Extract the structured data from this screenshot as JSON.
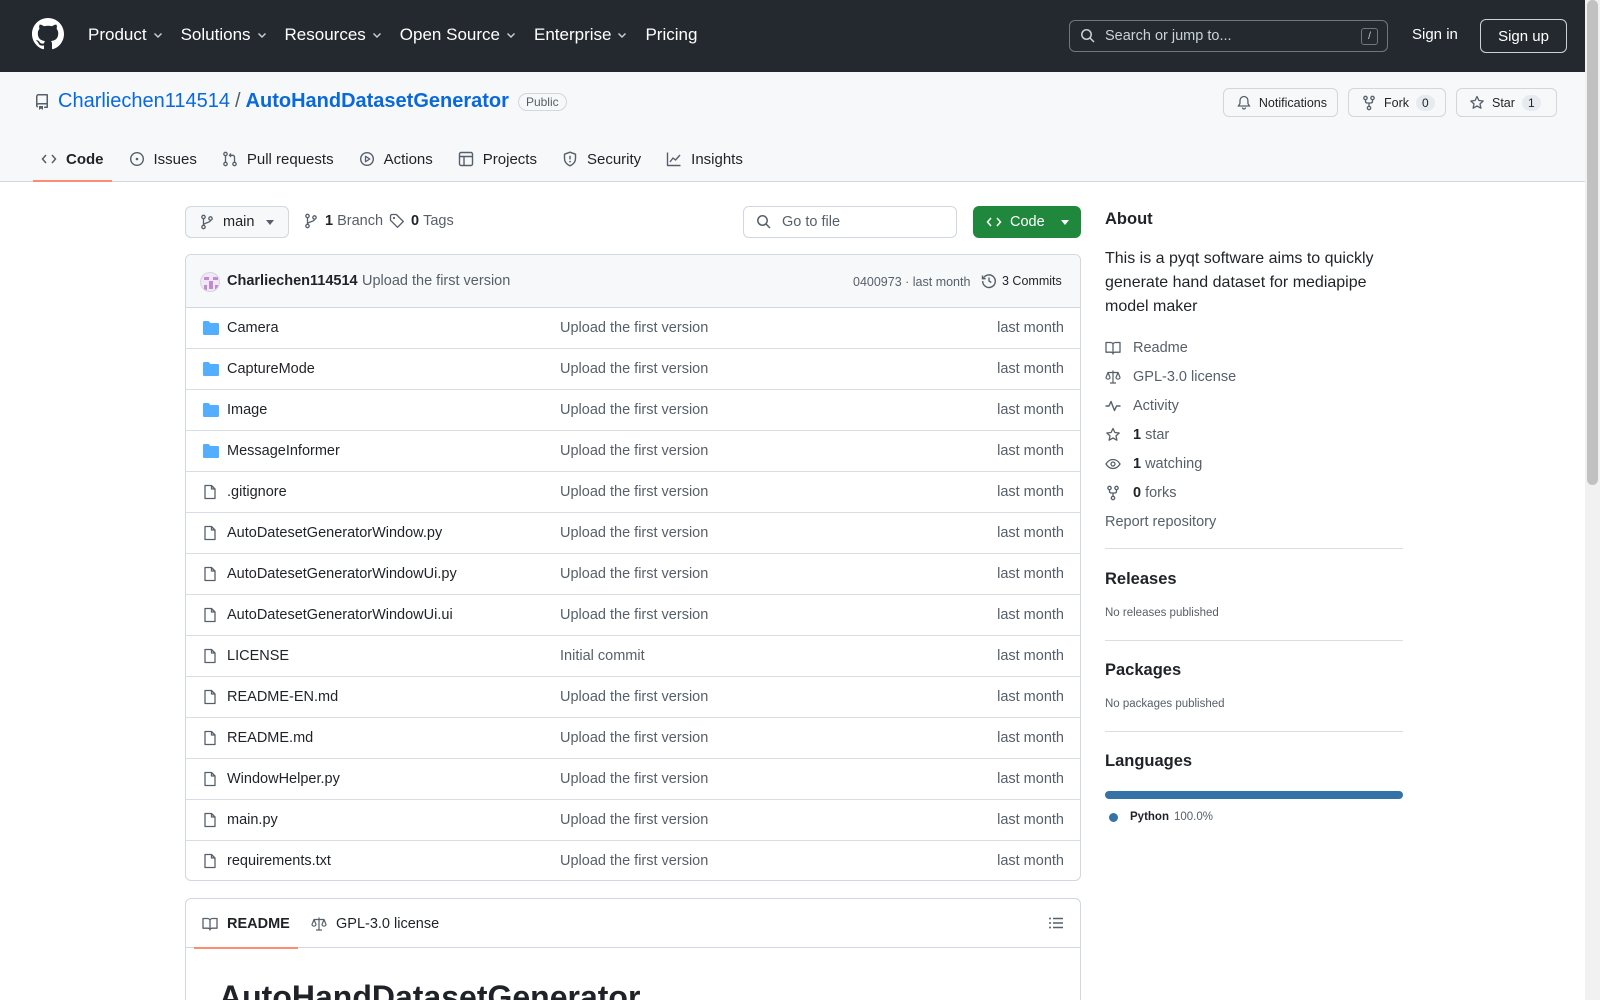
{
  "header": {
    "nav": [
      "Product",
      "Solutions",
      "Resources",
      "Open Source",
      "Enterprise",
      "Pricing"
    ],
    "search_placeholder": "Search or jump to...",
    "search_shortcut": "/",
    "sign_in": "Sign in",
    "sign_up": "Sign up"
  },
  "repo": {
    "owner": "Charliechen114514",
    "separator": "/",
    "name": "AutoHandDatasetGenerator",
    "visibility": "Public",
    "notifications_label": "Notifications",
    "fork_label": "Fork",
    "fork_count": "0",
    "star_label": "Star",
    "star_count": "1",
    "tabs": [
      "Code",
      "Issues",
      "Pull requests",
      "Actions",
      "Projects",
      "Security",
      "Insights"
    ]
  },
  "toolbar": {
    "branch": "main",
    "branch_count": "1",
    "branch_label": "Branch",
    "tag_count": "0",
    "tag_label": "Tags",
    "goto_placeholder": "Go to file",
    "code_label": "Code"
  },
  "commit": {
    "author": "Charliechen114514",
    "message": "Upload the first version",
    "meta": "0400973 · last month",
    "count": "3 Commits"
  },
  "files": [
    {
      "type": "dir",
      "name": "Camera",
      "message": "Upload the first version",
      "date": "last month"
    },
    {
      "type": "dir",
      "name": "CaptureMode",
      "message": "Upload the first version",
      "date": "last month"
    },
    {
      "type": "dir",
      "name": "Image",
      "message": "Upload the first version",
      "date": "last month"
    },
    {
      "type": "dir",
      "name": "MessageInformer",
      "message": "Upload the first version",
      "date": "last month"
    },
    {
      "type": "file",
      "name": ".gitignore",
      "message": "Upload the first version",
      "date": "last month"
    },
    {
      "type": "file",
      "name": "AutoDatesetGeneratorWindow.py",
      "message": "Upload the first version",
      "date": "last month"
    },
    {
      "type": "file",
      "name": "AutoDatesetGeneratorWindowUi.py",
      "message": "Upload the first version",
      "date": "last month"
    },
    {
      "type": "file",
      "name": "AutoDatesetGeneratorWindowUi.ui",
      "message": "Upload the first version",
      "date": "last month"
    },
    {
      "type": "file",
      "name": "LICENSE",
      "message": "Initial commit",
      "date": "last month"
    },
    {
      "type": "file",
      "name": "README-EN.md",
      "message": "Upload the first version",
      "date": "last month"
    },
    {
      "type": "file",
      "name": "README.md",
      "message": "Upload the first version",
      "date": "last month"
    },
    {
      "type": "file",
      "name": "WindowHelper.py",
      "message": "Upload the first version",
      "date": "last month"
    },
    {
      "type": "file",
      "name": "main.py",
      "message": "Upload the first version",
      "date": "last month"
    },
    {
      "type": "file",
      "name": "requirements.txt",
      "message": "Upload the first version",
      "date": "last month"
    }
  ],
  "readme": {
    "tab_readme": "README",
    "tab_license": "GPL-3.0 license",
    "heading": "AutoHandDatasetGenerator"
  },
  "about": {
    "title": "About",
    "description": "This is a pyqt software aims to quickly generate hand dataset for mediapipe model maker",
    "readme": "Readme",
    "license": "GPL-3.0 license",
    "activity": "Activity",
    "stars_count": "1",
    "stars_label": "star",
    "watching_count": "1",
    "watching_label": "watching",
    "forks_count": "0",
    "forks_label": "forks",
    "report": "Report repository"
  },
  "releases": {
    "title": "Releases",
    "text": "No releases published"
  },
  "packages": {
    "title": "Packages",
    "text": "No packages published"
  },
  "languages": {
    "title": "Languages",
    "items": [
      {
        "name": "Python",
        "percent": "100.0%",
        "color": "#3572a5",
        "fraction": 1.0
      }
    ]
  }
}
